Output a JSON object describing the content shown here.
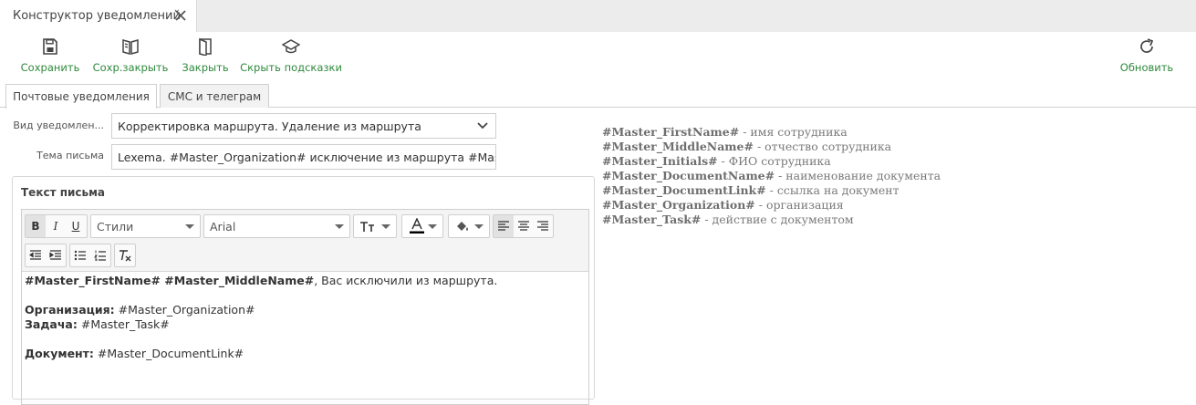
{
  "window": {
    "tab_title": "Конструктор уведомлений"
  },
  "toolbar": {
    "save_label": "Сохранить",
    "save_close_label": "Сохр.закрыть",
    "close_label": "Закрыть",
    "hide_hints_label": "Скрыть подсказки",
    "refresh_label": "Обновить"
  },
  "tabs": [
    {
      "label": "Почтовые уведомления",
      "active": true
    },
    {
      "label": "СМС и телеграм",
      "active": false
    }
  ],
  "form": {
    "type_label": "Вид уведомлен...",
    "type_value": "Корректировка маршрута. Удаление из маршрута",
    "subject_label": "Тема письма",
    "subject_value": "Lexema. #Master_Organization# исключение из маршрута #Master_Task#"
  },
  "editor": {
    "title": "Текст письма",
    "styles_value": "Стили",
    "font_value": "Arial",
    "body": {
      "line1_bold": "#Master_FirstName# #Master_MiddleName#",
      "line1_rest": ", Вас исключили из маршрута.",
      "org_label": "Организация:",
      "org_value": " #Master_Organization#",
      "task_label": "Задача:",
      "task_value": " #Master_Task#",
      "doc_label": "Документ:",
      "doc_value": " #Master_DocumentLink#"
    }
  },
  "hints": [
    {
      "key": "#Master_FirstName#",
      "desc": " - имя сотрудника"
    },
    {
      "key": "#Master_MiddleName#",
      "desc": " - отчество сотрудника"
    },
    {
      "key": "#Master_Initials#",
      "desc": " - ФИО сотрудника"
    },
    {
      "key": "#Master_DocumentName#",
      "desc": " - наименование документа"
    },
    {
      "key": "#Master_DocumentLink#",
      "desc": " - ссылка на документ"
    },
    {
      "key": "#Master_Organization#",
      "desc": " - организация"
    },
    {
      "key": "#Master_Task#",
      "desc": " - действие с документом"
    }
  ],
  "colors": {
    "accent_green": "#2f8a3c",
    "tabbar_bg": "#ececec"
  }
}
